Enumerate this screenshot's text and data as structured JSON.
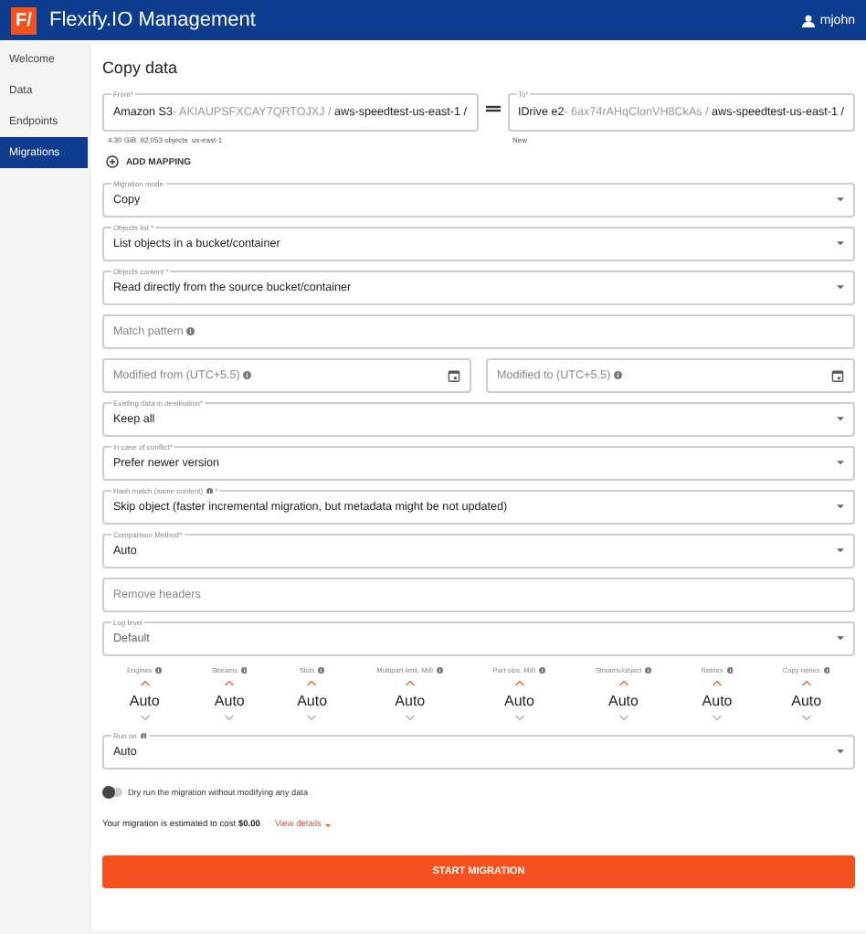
{
  "header": {
    "title": "Flexify.IO Management",
    "logo": "F/",
    "user": "mjohn"
  },
  "sidebar": {
    "items": [
      {
        "label": "Welcome",
        "selected": false
      },
      {
        "label": "Data",
        "selected": false
      },
      {
        "label": "Endpoints",
        "selected": false
      },
      {
        "label": "Migrations",
        "selected": true
      }
    ]
  },
  "page": {
    "title": "Copy data"
  },
  "mapping": {
    "from": {
      "label": "From*",
      "provider": "Amazon S3",
      "account": " - AKIAUPSFXCAY7QRTOJXJ /",
      "bucket": "aws-speedtest-us-east-1 /",
      "meta": "4.30 GiB  92,053 objects  us-east-1"
    },
    "to": {
      "label": "To*",
      "provider": "IDrive e2",
      "account": " - 6ax74rAHqClonVH8CkAs /",
      "bucket": "aws-speedtest-us-east-1 /",
      "meta": "New"
    },
    "add_button": "ADD MAPPING"
  },
  "fields": [
    {
      "kind": "select",
      "label": "Migration mode",
      "value": "Copy"
    },
    {
      "kind": "select",
      "label": "Objects list *",
      "value": "List objects in a bucket/container"
    },
    {
      "kind": "select",
      "label": "Objects content *",
      "value": "Read directly from the source bucket/container"
    },
    {
      "kind": "text",
      "placeholder": "Match pattern",
      "info": true
    },
    {
      "kind": "dates",
      "items": [
        {
          "placeholder": "Modified from (UTC+5.5)",
          "info": true
        },
        {
          "placeholder": "Modified to (UTC+5.5)",
          "info": true
        }
      ]
    },
    {
      "kind": "select",
      "label": "Existing data in destination*",
      "value": "Keep all"
    },
    {
      "kind": "select",
      "label": "In case of conflict*",
      "value": "Prefer newer version"
    },
    {
      "kind": "select",
      "label": "Hash match (same content)",
      "info": true,
      "suffix": "*",
      "value": "Skip object (faster incremental migration, but metadata might be not updated)"
    },
    {
      "kind": "select",
      "label": "Comparison Method*",
      "value": "Auto"
    },
    {
      "kind": "text",
      "placeholder": "Remove headers"
    },
    {
      "kind": "select",
      "label": "Log level",
      "value": "Default",
      "muted": true
    }
  ],
  "spinners": [
    {
      "label": "Engines",
      "value": "Auto"
    },
    {
      "label": "Streams",
      "value": "Auto"
    },
    {
      "label": "Slots",
      "value": "Auto"
    },
    {
      "label": "Multipart limit, MiB",
      "value": "Auto"
    },
    {
      "label": "Part size, MiB",
      "value": "Auto"
    },
    {
      "label": "Streams/object",
      "value": "Auto"
    },
    {
      "label": "Retries",
      "value": "Auto"
    },
    {
      "label": "Copy retries",
      "value": "Auto"
    }
  ],
  "run_on": {
    "label": "Run on",
    "info": true,
    "value": "Auto"
  },
  "dry_run": {
    "label": "Dry run the migration without modifying any data",
    "on": false
  },
  "cost": {
    "text": "Your migration is estimated to cost **$0.00**",
    "link": "View details"
  },
  "start_button": "START MIGRATION"
}
